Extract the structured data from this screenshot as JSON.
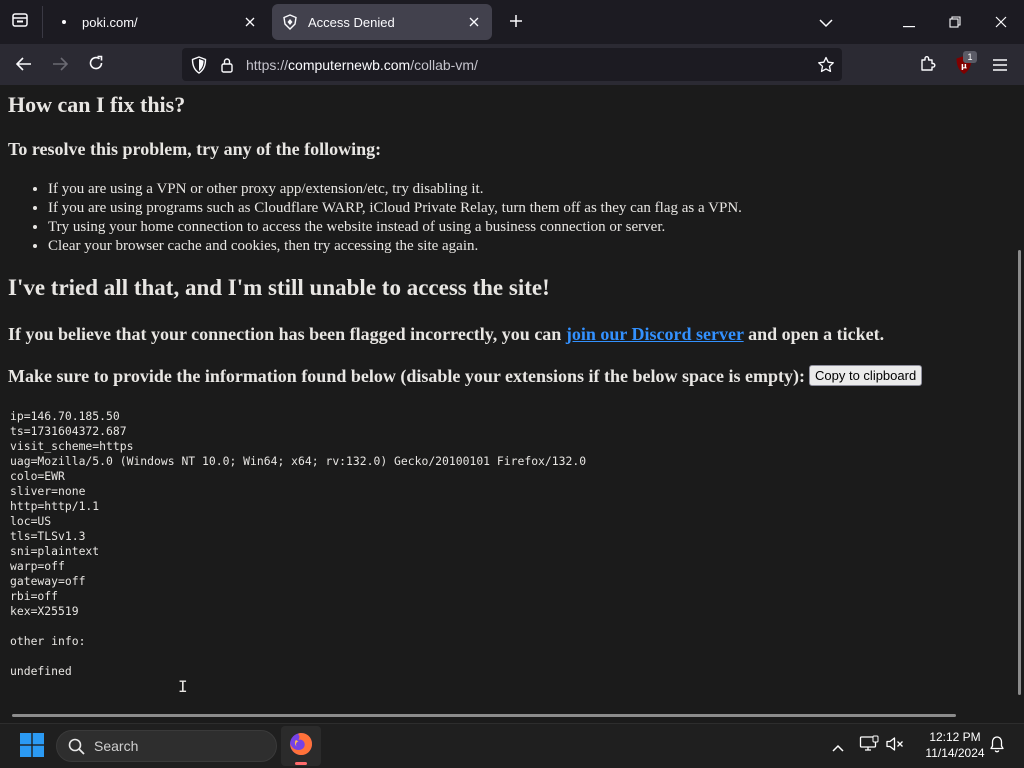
{
  "browser": {
    "tabs": [
      {
        "title": "poki.com/",
        "active": false
      },
      {
        "title": "Access Denied",
        "active": true
      }
    ],
    "url_prefix": "https://",
    "url_host": "computernewb.com",
    "url_path": "/collab-vm/",
    "extension_badge": "1"
  },
  "page": {
    "heading_fix": "How can I fix this?",
    "resolve_intro": "To resolve this problem, try any of the following:",
    "resolve_items": [
      "If you are using a VPN or other proxy app/extension/etc, try disabling it.",
      "If you are using programs such as Cloudflare WARP, iCloud Private Relay, turn them off as they can flag as a VPN.",
      "Try using your home connection to access the website instead of using a business connection or server.",
      "Clear your browser cache and cookies, then try accessing the site again."
    ],
    "heading_tried": "I've tried all that, and I'm still unable to access the site!",
    "flagged_before": "If you believe that your connection has been flagged incorrectly, you can ",
    "flagged_link": "join our Discord server",
    "flagged_after": " and open a ticket.",
    "provide_info": "Make sure to provide the information found below (disable your extensions if the below space is empty):",
    "copy_button": "Copy to clipboard",
    "info_lines": [
      "ip=146.70.185.50",
      "ts=1731604372.687",
      "visit_scheme=https",
      "uag=Mozilla/5.0 (Windows NT 10.0; Win64; x64; rv:132.0) Gecko/20100101 Firefox/132.0",
      "colo=EWR",
      "sliver=none",
      "http=http/1.1",
      "loc=US",
      "tls=TLSv1.3",
      "sni=plaintext",
      "warp=off",
      "gateway=off",
      "rbi=off",
      "kex=X25519",
      "",
      "other info:",
      "",
      "undefined"
    ]
  },
  "taskbar": {
    "search_placeholder": "Search",
    "time": "12:12 PM",
    "date": "11/14/2024"
  },
  "colors": {
    "link": "#3391ff",
    "firefox_orange": "#ff7139",
    "windows_blue": "#2b9af3"
  }
}
